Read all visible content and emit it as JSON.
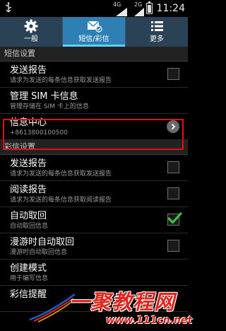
{
  "status_bar": {
    "time": "11:24",
    "network_1": "4G",
    "network_2": "2G",
    "battery_level": 0.8
  },
  "tabs": [
    {
      "label": "一般",
      "icon": "gear-icon",
      "active": false
    },
    {
      "label": "短信/彩信",
      "icon": "message-icon",
      "active": true
    },
    {
      "label": "更多",
      "icon": "more-list-icon",
      "active": false
    }
  ],
  "sms_section": {
    "header": "短信设置",
    "items": [
      {
        "title": "发送报告",
        "subtitle": "请求为发送的每条信息获取发送报告",
        "control": "checkbox",
        "checked": false
      },
      {
        "title": "管理 SIM 卡信息",
        "subtitle": "管理存储在 SIM 卡上的信息",
        "control": "none"
      },
      {
        "title": "信息中心",
        "subtitle": "+8613800100500",
        "control": "chevron"
      }
    ]
  },
  "mms_section": {
    "header": "彩信设置",
    "items": [
      {
        "title": "发送报告",
        "subtitle": "请求为发送的每条信息获取发送报告",
        "control": "checkbox",
        "checked": false
      },
      {
        "title": "阅读报告",
        "subtitle": "请求为发送的每条信息获取阅读报告",
        "control": "checkbox",
        "checked": false
      },
      {
        "title": "自动取回",
        "subtitle": "自动取回信息",
        "control": "checkbox",
        "checked": true
      },
      {
        "title": "漫游时自动取回",
        "subtitle": "漫游时自动取回信息",
        "control": "checkbox",
        "checked": false
      },
      {
        "title": "创建模式",
        "subtitle": "用于编写信息",
        "control": "none"
      },
      {
        "title": "彩信提醒",
        "subtitle": "",
        "control": "none"
      }
    ]
  },
  "watermark": {
    "main": "一聚教程网",
    "url": "www.111cn.net"
  },
  "colors": {
    "tab_bar": "#2b4256",
    "tab_active": "#2e7fb3",
    "highlight_frame": "#e21010",
    "check_green": "#3ec03e"
  }
}
